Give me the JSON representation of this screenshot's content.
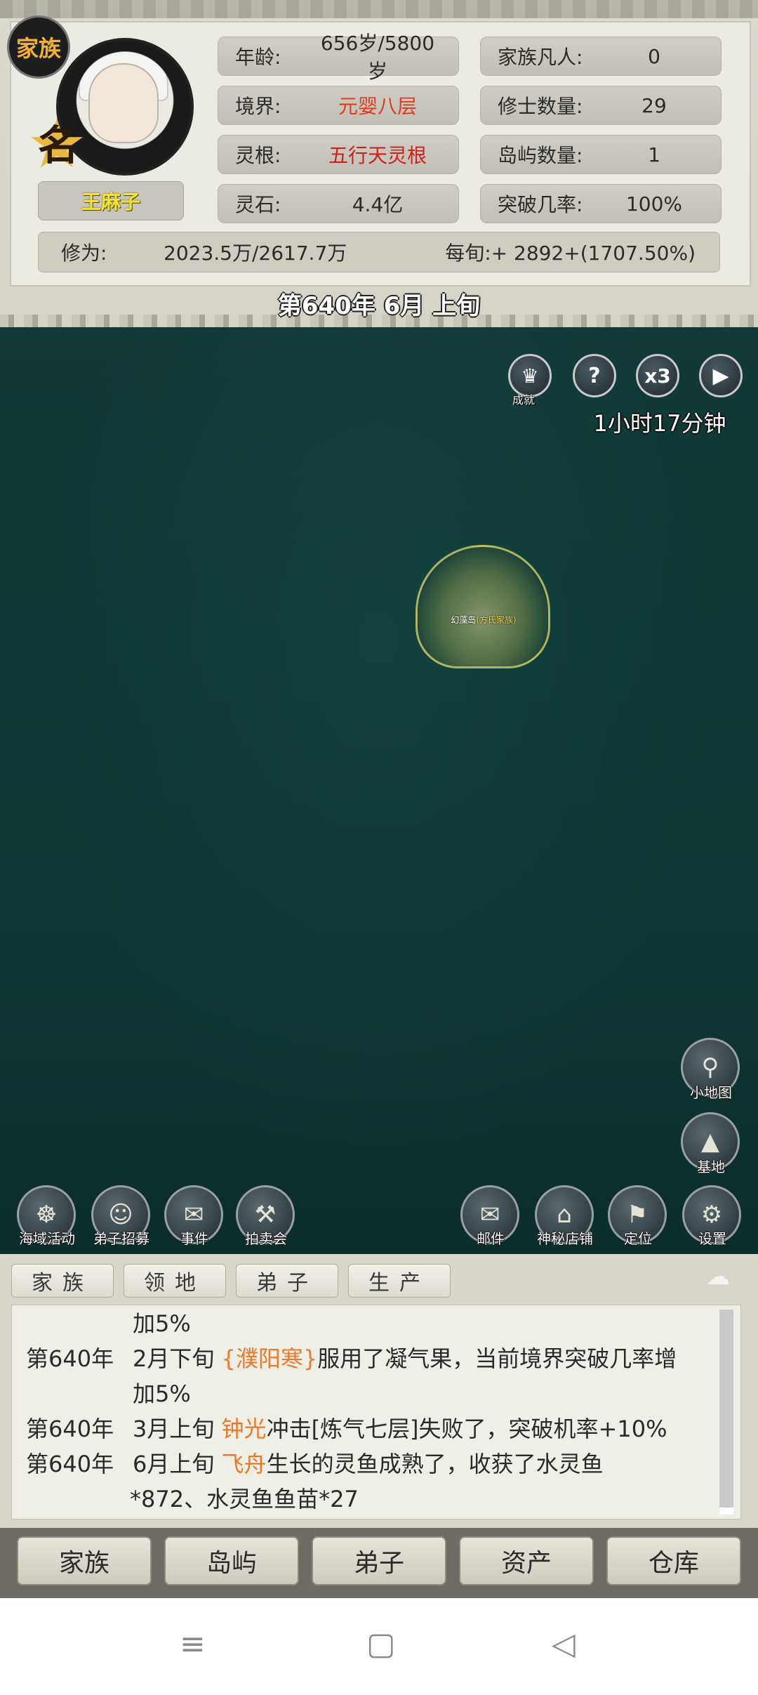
{
  "header": {
    "clan_badge": "家族",
    "name_badge_char": "名",
    "player_name": "王麻子",
    "stats_left": [
      {
        "label": "年龄:",
        "value": "656岁/5800岁",
        "color": "#2b2b2b"
      },
      {
        "label": "境界:",
        "value": "元婴八层",
        "color": "#e03a20"
      },
      {
        "label": "灵根:",
        "value": "五行天灵根",
        "color": "#d0201a"
      },
      {
        "label": "灵石:",
        "value": "4.4亿",
        "color": "#2b2b2b"
      }
    ],
    "stats_right": [
      {
        "label": "家族凡人:",
        "value": "0"
      },
      {
        "label": "修士数量:",
        "value": "29"
      },
      {
        "label": "岛屿数量:",
        "value": "1"
      },
      {
        "label": "突破几率:",
        "value": "100%"
      }
    ],
    "cultivation_label": "修为:",
    "cultivation_value": "2023.5万/2617.7万",
    "cultivation_rate": "每旬:+ 2892+(1707.50%)",
    "date": "第640年 6月 上旬"
  },
  "controls": {
    "achievement_label": "成就",
    "help": "?",
    "speed": "x3",
    "play": "▶",
    "timer": "1小时17分钟"
  },
  "island": {
    "name": "幻藻岛",
    "clan": "(方氏家族)"
  },
  "map_buttons": {
    "minimap": "小地图",
    "base": "基地"
  },
  "actions_left": [
    {
      "label": "海域活动",
      "icon": "sea-activity-icon"
    },
    {
      "label": "弟子招募",
      "icon": "recruit-icon"
    },
    {
      "label": "事件",
      "icon": "scroll-icon"
    },
    {
      "label": "拍卖会",
      "icon": "gavel-icon"
    }
  ],
  "actions_right": [
    {
      "label": "邮件",
      "icon": "mail-icon"
    },
    {
      "label": "神秘店铺",
      "icon": "shop-icon"
    },
    {
      "label": "定位",
      "icon": "flag-icon"
    },
    {
      "label": "设置",
      "icon": "gear-icon"
    }
  ],
  "log_tabs": [
    "家族",
    "领地",
    "弟子",
    "生产"
  ],
  "log": {
    "lines": [
      {
        "year": "",
        "pre": "加5%",
        "name": "",
        "post": ""
      },
      {
        "year": "第640年",
        "pre": "2月下旬 ",
        "name": "{濮阳寒}",
        "post": "服用了凝气果，当前境界突破几率增"
      },
      {
        "year": "",
        "pre": "加5%",
        "name": "",
        "post": ""
      },
      {
        "year": "第640年",
        "pre": "3月上旬 ",
        "name": "钟光",
        "post": "冲击[炼气七层]失败了，突破机率+10%"
      },
      {
        "year": "第640年",
        "pre": "6月上旬 ",
        "name": "飞舟",
        "post": "生长的灵鱼成熟了，收获了水灵鱼"
      },
      {
        "year": "",
        "pre": "*872、水灵鱼鱼苗*27",
        "name": "",
        "post": ""
      }
    ]
  },
  "bottom_nav": [
    "家族",
    "岛屿",
    "弟子",
    "资产",
    "仓库"
  ],
  "system_nav": {
    "menu": "≡",
    "home": "▢",
    "back": "◁"
  }
}
